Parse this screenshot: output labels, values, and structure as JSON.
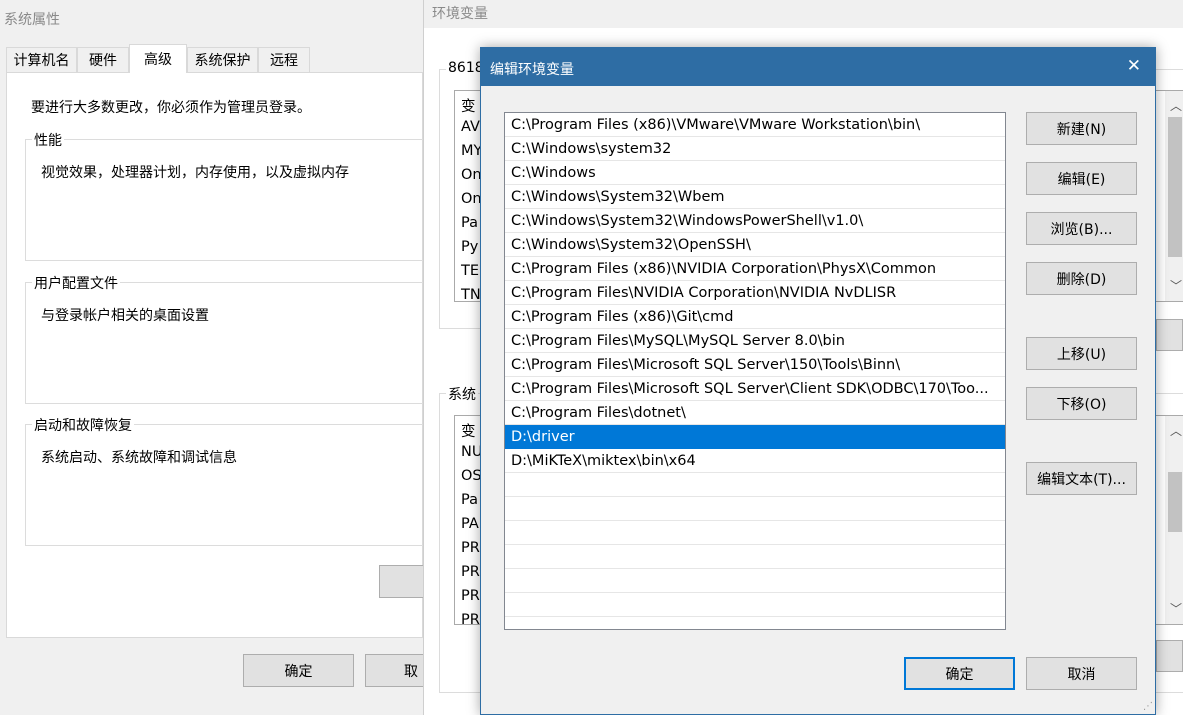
{
  "sysprop": {
    "title": "系统属性",
    "tabs": [
      "计算机名",
      "硬件",
      "高级",
      "系统保护",
      "远程"
    ],
    "admin_note": "要进行大多数更改，你必须作为管理员登录。",
    "performance": {
      "legend": "性能",
      "desc": "视觉效果，处理器计划，内存使用，以及虚拟内存"
    },
    "profiles": {
      "legend": "用户配置文件",
      "desc": "与登录帐户相关的桌面设置"
    },
    "startup": {
      "legend": "启动和故障恢复",
      "desc": "系统启动、系统故障和调试信息"
    },
    "ok_label": "确定",
    "cancel_label_partial": "取"
  },
  "envvars": {
    "title": "环境变量",
    "user_section_partial": "8618",
    "user_rows_partial": [
      "变",
      "AV",
      "MY",
      "On",
      "On",
      "Pa",
      "Py",
      "TE",
      "TN"
    ],
    "system_section_partial": "系统",
    "system_rows_partial": [
      "变",
      "NU",
      "OS",
      "Pa",
      "PA",
      "PR",
      "PR",
      "PR",
      "PR"
    ]
  },
  "editdlg": {
    "title": "编辑环境变量",
    "close_glyph": "✕",
    "paths": [
      "C:\\Program Files (x86)\\VMware\\VMware Workstation\\bin\\",
      "C:\\Windows\\system32",
      "C:\\Windows",
      "C:\\Windows\\System32\\Wbem",
      "C:\\Windows\\System32\\WindowsPowerShell\\v1.0\\",
      "C:\\Windows\\System32\\OpenSSH\\",
      "C:\\Program Files (x86)\\NVIDIA Corporation\\PhysX\\Common",
      "C:\\Program Files\\NVIDIA Corporation\\NVIDIA NvDLISR",
      "C:\\Program Files (x86)\\Git\\cmd",
      "C:\\Program Files\\MySQL\\MySQL Server 8.0\\bin",
      "C:\\Program Files\\Microsoft SQL Server\\150\\Tools\\Binn\\",
      "C:\\Program Files\\Microsoft SQL Server\\Client SDK\\ODBC\\170\\Too...",
      "C:\\Program Files\\dotnet\\",
      "D:\\driver",
      "D:\\MiKTeX\\miktex\\bin\\x64"
    ],
    "selected_index": 13,
    "empty_rows": 7,
    "buttons": {
      "new": "新建(N)",
      "edit": "编辑(E)",
      "browse": "浏览(B)...",
      "delete": "删除(D)",
      "move_up": "上移(U)",
      "move_down": "下移(O)",
      "edit_text": "编辑文本(T)..."
    },
    "ok_label": "确定",
    "cancel_label": "取消",
    "title_bar_color": "#2e6da4"
  }
}
